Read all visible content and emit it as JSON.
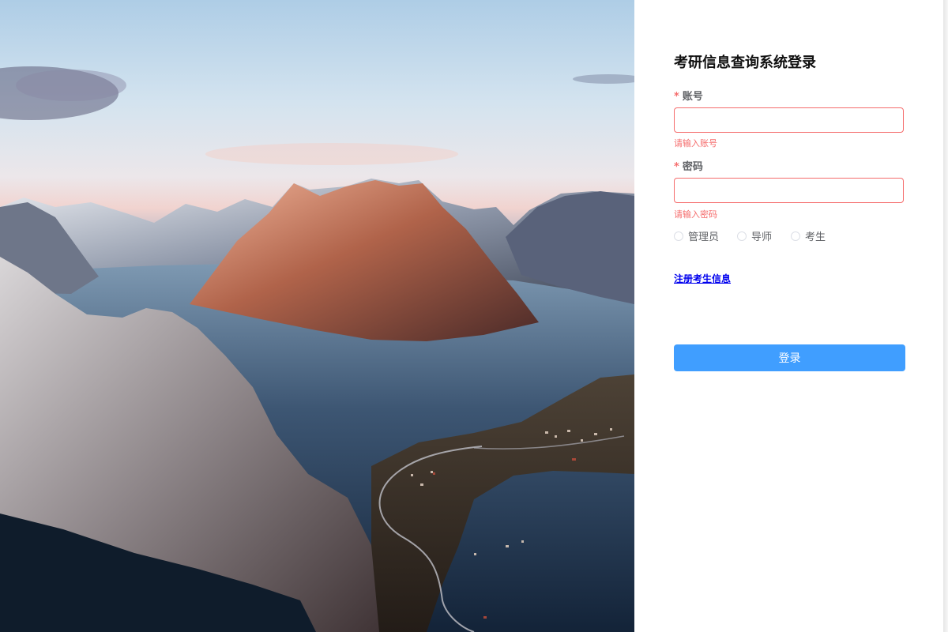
{
  "page": {
    "title": "考研信息查询系统登录"
  },
  "form": {
    "account": {
      "label": "账号",
      "required_mark": "*",
      "value": "",
      "error": "请输入账号"
    },
    "password": {
      "label": "密码",
      "required_mark": "*",
      "value": "",
      "error": "请输入密码"
    },
    "roles": [
      {
        "label": "管理员",
        "selected": false
      },
      {
        "label": "导师",
        "selected": false
      },
      {
        "label": "考生",
        "selected": false
      }
    ],
    "register_link": "注册考生信息",
    "login_button": "登录"
  },
  "colors": {
    "accent": "#409eff",
    "error": "#f56c6c",
    "link": "#0000ee",
    "text": "#606266",
    "title": "#111111"
  }
}
